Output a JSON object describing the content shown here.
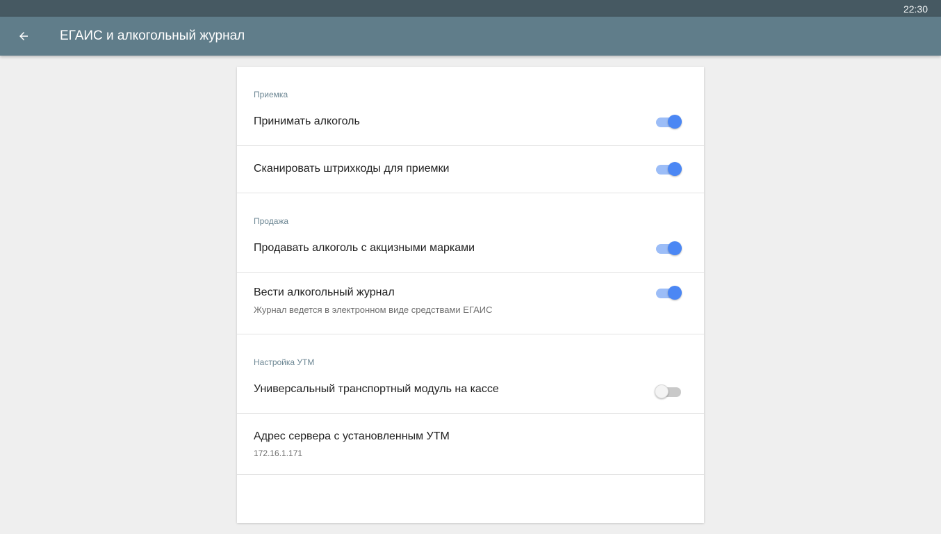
{
  "status_bar": {
    "time": "22:30"
  },
  "app_bar": {
    "title": "ЕГАИС и алкогольный журнал",
    "back_icon": "arrow-left-icon"
  },
  "colors": {
    "app_bar": "#607d8a",
    "status_bar": "#465962",
    "switch_on_thumb": "#4b87f4",
    "switch_on_track": "#9cbdf7",
    "section_header": "#6c8693"
  },
  "sections": {
    "receiving": {
      "header": "Приемка",
      "accept_alcohol": {
        "title": "Принимать алкоголь",
        "enabled": true
      },
      "scan_barcodes": {
        "title": "Сканировать штрихкоды для приемки",
        "enabled": true
      }
    },
    "sales": {
      "header": "Продажа",
      "sell_excise": {
        "title": "Продавать алкоголь с акцизными марками",
        "enabled": true
      },
      "keep_journal": {
        "title": "Вести алкогольный журнал",
        "subtitle": "Журнал ведется в электронном виде средствами ЕГАИС",
        "enabled": true
      }
    },
    "utm": {
      "header": "Настройка УТМ",
      "utm_on_register": {
        "title": "Универсальный транспортный модуль на кассе",
        "enabled": false
      },
      "server_address": {
        "title": "Адрес сервера с установленным УТМ",
        "value": "172.16.1.171"
      }
    }
  }
}
